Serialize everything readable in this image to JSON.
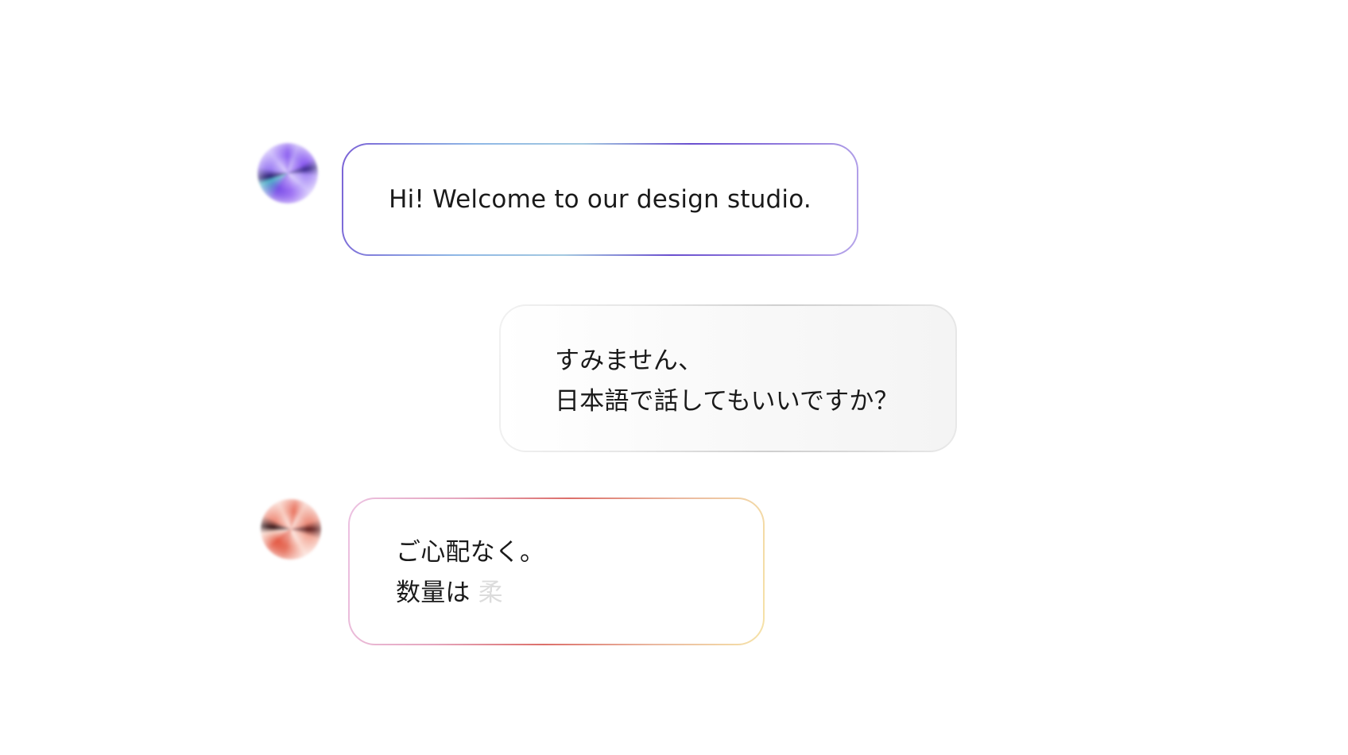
{
  "conversation": {
    "messages": [
      {
        "role": "assistant",
        "avatar_icon": "gradient-orb-purple-icon",
        "lines": [
          "Hi! Welcome to our design studio."
        ]
      },
      {
        "role": "user",
        "lines": [
          "すみません、",
          "日本語で話してもいいですか？"
        ]
      },
      {
        "role": "assistant",
        "avatar_icon": "gradient-orb-coral-icon",
        "lines": [
          "ご心配なく。",
          "数量は"
        ],
        "typing_char": "柔"
      }
    ]
  },
  "colors": {
    "assistant_border_accent": "#6a4fcf",
    "assistant_2_border_accent": "#dc6f6a",
    "user_bubble_bg": "#f6f6f6",
    "text": "#1a1a1a",
    "typing_ghost": "#dcdcdc"
  }
}
